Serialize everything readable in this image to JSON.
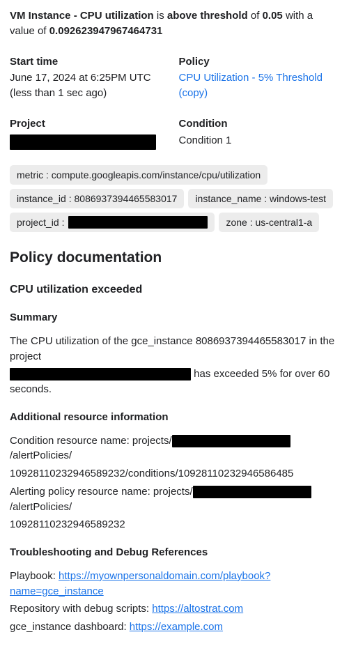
{
  "header": {
    "p1": "VM Instance - CPU utilization",
    "p2": " is ",
    "p3": "above threshold",
    "p4": " of ",
    "p5": "0.05",
    "p6": " with a value of ",
    "p7": "0.092623947967464731"
  },
  "meta": {
    "start_label": "Start time",
    "start_value": "June 17, 2024 at 6:25PM UTC (less than 1 sec ago)",
    "policy_label": "Policy",
    "policy_link": "CPU Utilization - 5% Threshold (copy)",
    "project_label": "Project",
    "condition_label": "Condition",
    "condition_value": "Condition 1"
  },
  "chips": {
    "metric": "metric : compute.googleapis.com/instance/cpu/utilization",
    "instance_id": "instance_id : 8086937394465583017",
    "instance_name": "instance_name : windows-test",
    "project_id_prefix": "project_id :",
    "zone": "zone : us-central1-a"
  },
  "doc": {
    "heading": "Policy documentation",
    "sub1": "CPU utilization exceeded",
    "summary_h": "Summary",
    "summary_l1": "The CPU utilization of the gce_instance 8086937394465583017 in the project",
    "summary_l2_suffix": " has exceeded 5% for over 60 seconds.",
    "addl_h": "Additional resource information",
    "cond_prefix": "Condition resource name: projects/",
    "cond_mid": "/alertPolicies/",
    "cond_tail": "10928110232946589232/conditions/10928110232946586485",
    "alert_prefix": "Alerting policy resource name: projects/",
    "alert_mid": "/alertPolicies/",
    "alert_tail": "10928110232946589232",
    "trouble_h": "Troubleshooting and Debug References",
    "playbook_label": "Playbook: ",
    "playbook_link": "https://myownpersonaldomain.com/playbook?name=gce_instance",
    "repo_label": "Repository with debug scripts: ",
    "repo_link": "https://altostrat.com",
    "dash_label": "gce_instance dashboard: ",
    "dash_link": "https://example.com"
  }
}
